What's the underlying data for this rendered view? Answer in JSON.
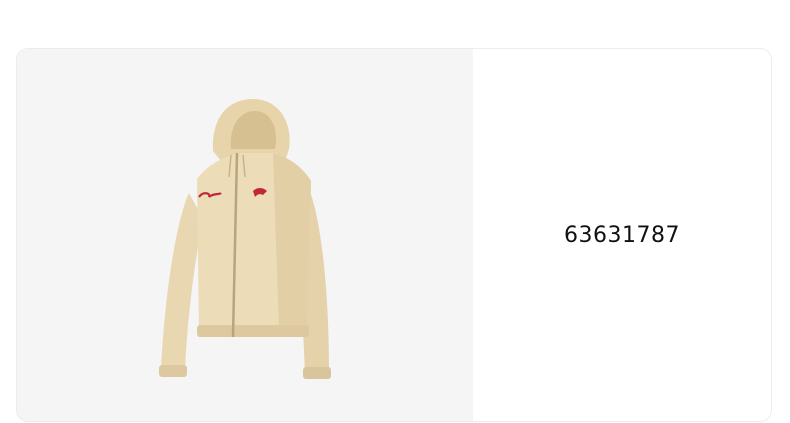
{
  "product": {
    "id": "63631787",
    "image_alt": "product-photo-beige-zip-hoodie",
    "chest_logo_text": "Puma",
    "colors": {
      "garment": "#ecdcb8",
      "garment_shade": "#d9c59c",
      "accent_red": "#c0283a",
      "zipper": "#b8a57e",
      "image_bg": "#f5f5f5"
    }
  }
}
